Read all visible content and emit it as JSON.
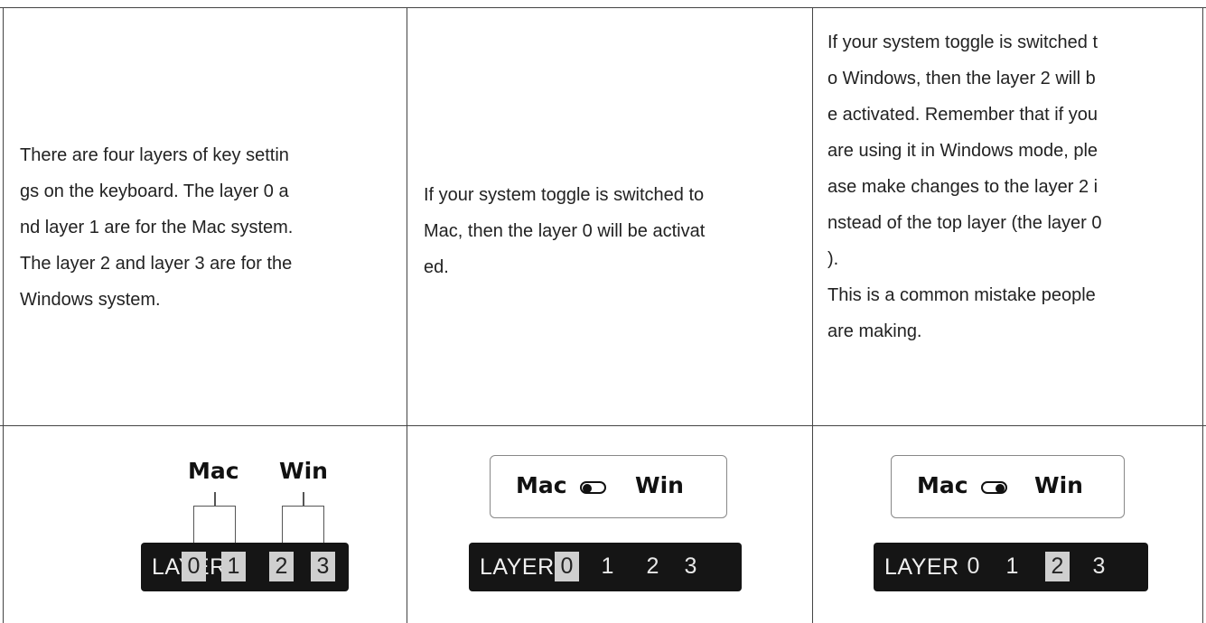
{
  "cells": {
    "col1_lines": [
      "There are four layers of key settin",
      "gs on the keyboard. The layer 0 a",
      "nd layer 1 are for the Mac system.",
      "The layer 2 and layer 3 are for the",
      "Windows system."
    ],
    "col2_lines": [
      "If your system toggle is switched to",
      "Mac, then the layer 0 will be activat",
      "ed."
    ],
    "col3_lines": [
      "If your system toggle is switched t",
      "o Windows, then the layer 2 will b",
      "e activated. Remember that if you",
      "are using it in Windows mode, ple",
      "ase make changes to the layer 2 i",
      "nstead of the top layer (the layer 0",
      ").",
      "This is a common mistake people",
      "are making."
    ]
  },
  "diagrams": {
    "layer_word": "LAYER",
    "layer_numbers": [
      "0",
      "1",
      "2",
      "3"
    ],
    "mac_label": "Mac",
    "win_label": "Win",
    "diagram1": {
      "boxed_layers": [
        "0",
        "1",
        "2",
        "3"
      ]
    },
    "diagram2": {
      "toggle_state": "Mac",
      "boxed_layers": [
        "0"
      ]
    },
    "diagram3": {
      "toggle_state": "Win",
      "boxed_layers": [
        "2"
      ]
    }
  },
  "colors": {
    "bar": "#151515",
    "highlight": "#cfcfcf",
    "grid_line": "#444444"
  }
}
